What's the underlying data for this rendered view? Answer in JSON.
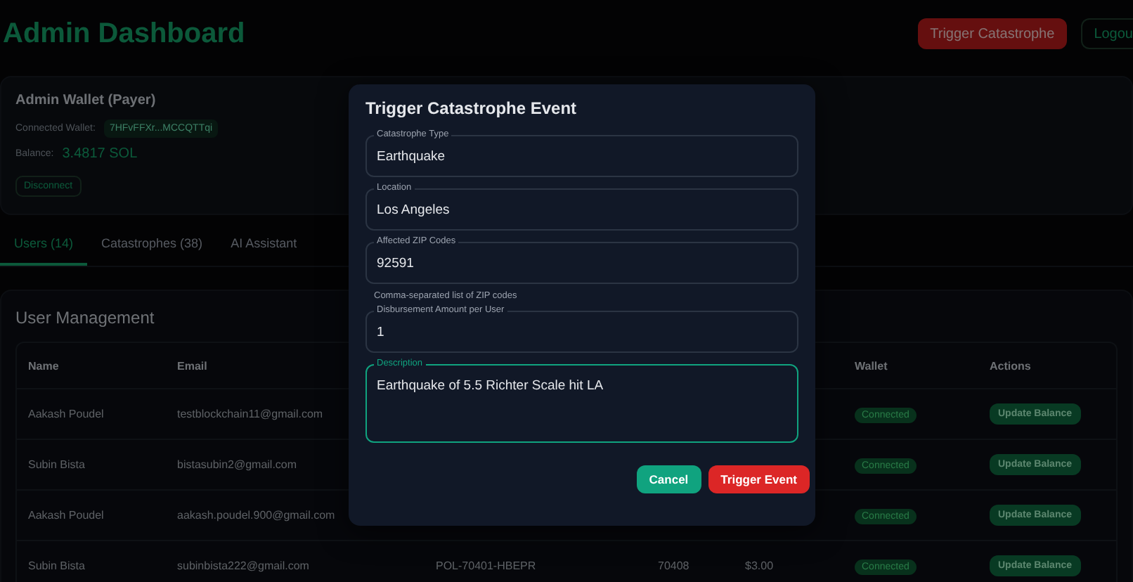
{
  "header": {
    "title": "Admin Dashboard",
    "buttons": [
      {
        "label": "Trigger Catastrophe",
        "kind": "danger"
      },
      {
        "label": "Logou",
        "kind": "outline"
      }
    ]
  },
  "wallet_card": {
    "title": "Admin Wallet (Payer)",
    "connected_label": "Connected Wallet:",
    "address": "7HFvFFXr...MCCQTTqi",
    "balance_label": "Balance:",
    "balance": "3.4817 SOL",
    "disconnect": "Disconnect"
  },
  "tabs": [
    {
      "label": "Users (14)",
      "selected": true
    },
    {
      "label": "Catastrophes (38)",
      "selected": false
    },
    {
      "label": "AI Assistant",
      "selected": false
    }
  ],
  "user_management": {
    "title": "User Management",
    "columns": [
      "Name",
      "Email",
      "Wallet",
      "Actions"
    ],
    "rows": [
      {
        "name": "Aakash Poudel",
        "email": "testblockchain11@gmail.com",
        "wallet": "Connected",
        "action": "Update Balance"
      },
      {
        "name": "Subin Bista",
        "email": "bistasubin2@gmail.com",
        "wallet": "Connected",
        "action": "Update Balance"
      },
      {
        "name": "Aakash Poudel",
        "email": "aakash.poudel.900@gmail.com",
        "wallet": "Connected",
        "action": "Update Balance"
      },
      {
        "name": "Subin Bista",
        "email": "subinbista222@gmail.com",
        "column_3": "POL-70401-HBEPR",
        "column_4": "70408",
        "column_5": "$3.00",
        "wallet": "Connected",
        "action": "Update Balance"
      }
    ]
  },
  "dialog": {
    "title": "Trigger Catastrophe Event",
    "fields": [
      {
        "label": "Catastrophe Type",
        "value": "Earthquake",
        "kind": "input",
        "focused": false
      },
      {
        "label": "Location",
        "value": "Los Angeles",
        "kind": "input",
        "focused": false
      },
      {
        "label": "Affected ZIP Codes",
        "value": "92591",
        "kind": "input",
        "focused": false,
        "helper": "Comma-separated list of ZIP codes"
      },
      {
        "label": "Disbursement Amount per User",
        "value": "1",
        "kind": "input",
        "focused": false
      },
      {
        "label": "Description",
        "value": "Earthquake of 5.5 Richter Scale hit LA",
        "kind": "textarea",
        "focused": true
      }
    ],
    "buttons": [
      {
        "label": "Cancel",
        "kind": "secondary"
      },
      {
        "label": "Trigger Event",
        "kind": "danger"
      }
    ]
  }
}
